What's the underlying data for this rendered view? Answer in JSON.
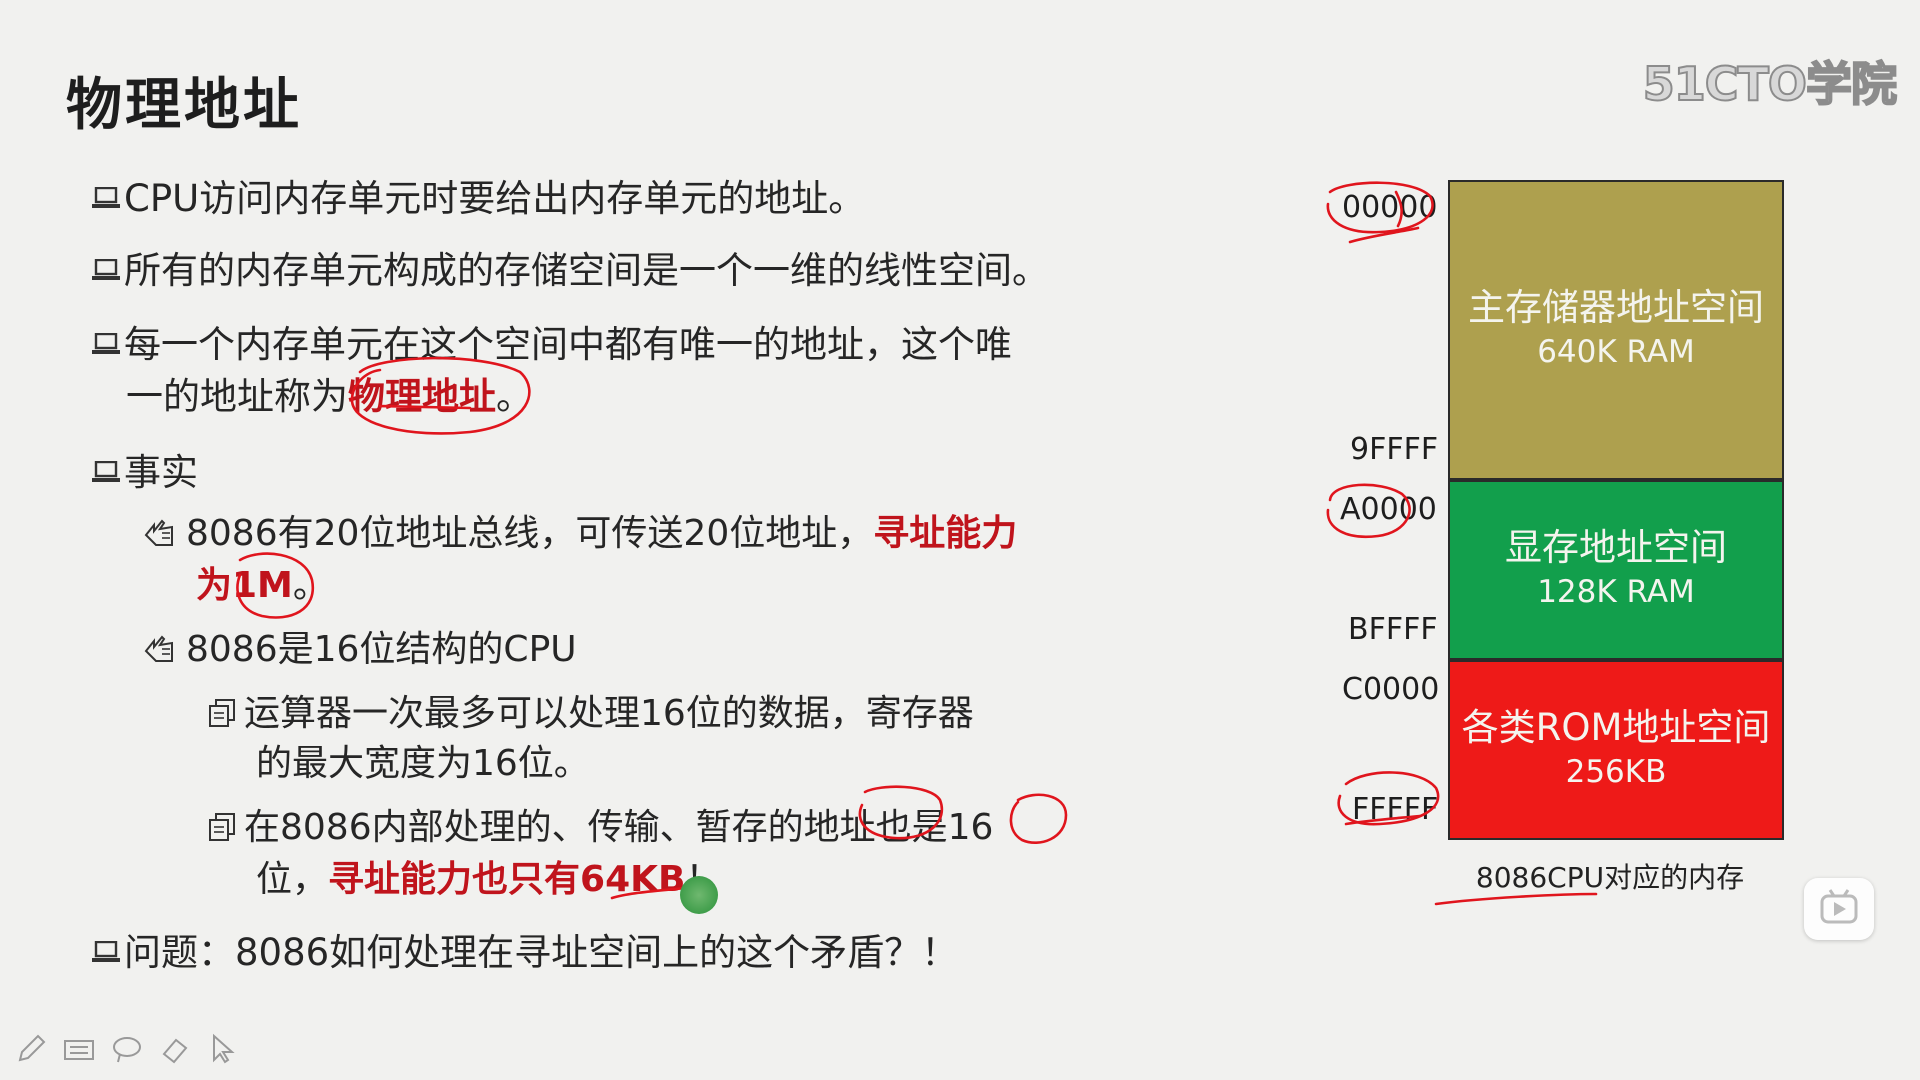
{
  "slide": {
    "title": "物理地址",
    "watermark": "51CTO学院",
    "bullets": {
      "b1": "CPU访问内存单元时要给出内存单元的地址。",
      "b2": "所有的内存单元构成的存储空间是一个一维的线性空间。",
      "b3_line1": "每一个内存单元在这个空间中都有唯一的地址，这个唯",
      "b3_line2_pre": "一的地址称为",
      "b3_line2_red": "物理地址",
      "b3_line2_post": "。",
      "b4": "事实",
      "s1_line1_pre": "8086有20位地址总线，可传送20位地址，",
      "s1_line1_red": "寻址能力",
      "s1_line2_red": "为1M",
      "s1_line2_post": "。",
      "s2": "8086是16位结构的CPU",
      "t1_line1": "运算器一次最多可以处理16位的数据，寄存器",
      "t1_line2": "的最大宽度为16位。",
      "t2_line1": "在8086内部处理的、传输、暂存的地址也是16",
      "t2_line2_pre": "位，",
      "t2_line2_red": "寻址能力也只有64KB",
      "t2_line2_post": "！",
      "b5": "问题：8086如何处理在寻址空间上的这个矛盾？！"
    },
    "memory": {
      "blocks": [
        {
          "name": "主存储器地址空间",
          "size": "640K RAM",
          "color": "#aea04e"
        },
        {
          "name": "显存地址空间",
          "size": "128K RAM",
          "color": "#129f4c"
        },
        {
          "name": "各类ROM地址空间",
          "size": "256KB",
          "color": "#ee1a18"
        }
      ],
      "addresses": {
        "a1": "00000",
        "a2": "9FFFF",
        "a3": "A0000",
        "a4": "BFFFF",
        "a5": "C0000",
        "a6": "FFFFF"
      },
      "caption": "8086CPU对应的内存"
    }
  },
  "icons": {
    "pen": "pen-icon",
    "keyboard": "keyboard-icon",
    "lasso": "lasso-icon",
    "eraser": "eraser-icon",
    "cursor": "cursor-icon",
    "play": "play-icon"
  }
}
